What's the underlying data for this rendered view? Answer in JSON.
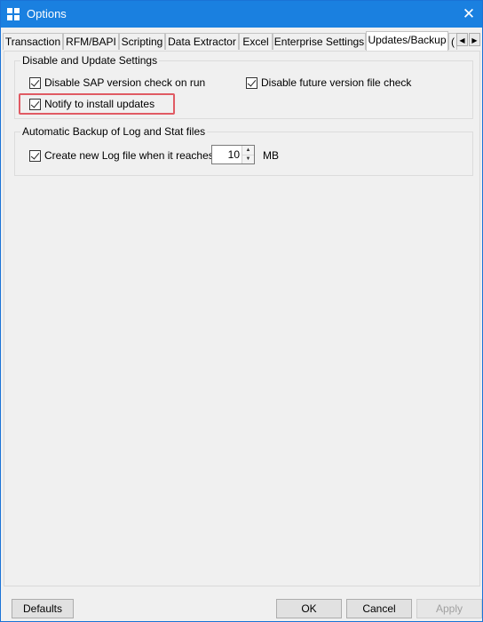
{
  "window": {
    "title": "Options",
    "icon": "grid-app-icon",
    "close_icon": "close-icon",
    "title_bar_color": "#1a80e0"
  },
  "tabs": [
    {
      "label": "Transaction"
    },
    {
      "label": "RFM/BAPI"
    },
    {
      "label": "Scripting"
    },
    {
      "label": "Data Extractor"
    },
    {
      "label": "Excel"
    },
    {
      "label": "Enterprise Settings"
    },
    {
      "label": "Updates/Backup",
      "active": true
    },
    {
      "label": "("
    }
  ],
  "tab_scroll": {
    "left_icon": "scroll-left-icon",
    "right_icon": "scroll-right-icon"
  },
  "disable_update_group": {
    "title": "Disable and Update Settings",
    "disable_sap_check": {
      "label": "Disable SAP version check on run",
      "checked": true
    },
    "disable_future_check": {
      "label": "Disable future version file check",
      "checked": true
    },
    "notify_updates": {
      "label": "Notify to install updates",
      "checked": true
    }
  },
  "backup_group": {
    "title": "Automatic Backup of Log and Stat files",
    "create_log": {
      "label": "Create new Log file when it reaches",
      "checked": true
    },
    "log_size_value": "10",
    "unit_label": "MB"
  },
  "highlight_color": "#e05a63",
  "buttons": {
    "defaults": "Defaults",
    "ok": "OK",
    "cancel": "Cancel",
    "apply": "Apply"
  }
}
